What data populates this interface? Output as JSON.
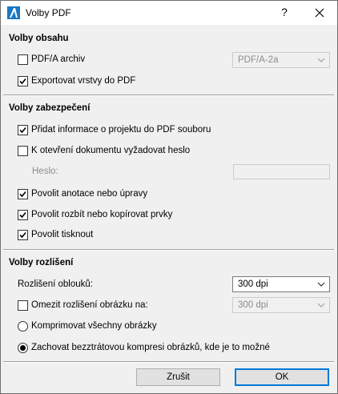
{
  "window": {
    "title": "Volby PDF",
    "help_label": "?"
  },
  "content_section": {
    "title": "Volby obsahu",
    "pdfa": {
      "label": "PDF/A archiv",
      "checked": false,
      "select_value": "PDF/A-2a"
    },
    "export_layers": {
      "label": "Exportovat vrstvy do PDF",
      "checked": true
    }
  },
  "security_section": {
    "title": "Volby zabezpečení",
    "add_project_info": {
      "label": "Přidat informace o projektu do PDF souboru",
      "checked": true
    },
    "require_password": {
      "label": "K otevření dokumentu vyžadovat heslo",
      "checked": false
    },
    "password": {
      "label": "Heslo:",
      "value": ""
    },
    "allow_annotations": {
      "label": "Povolit anotace nebo úpravy",
      "checked": true
    },
    "allow_extract": {
      "label": "Povolit rozbít nebo kopírovat prvky",
      "checked": true
    },
    "allow_print": {
      "label": "Povolit tisknout",
      "checked": true
    }
  },
  "resolution_section": {
    "title": "Volby rozlišení",
    "arc_resolution": {
      "label": "Rozlišení oblouků:",
      "value": "300 dpi"
    },
    "limit_image_resolution": {
      "label": "Omezit rozlišení obrázku na:",
      "checked": false,
      "value": "300 dpi"
    },
    "compress_all": {
      "label": "Komprimovat všechny obrázky",
      "selected": false
    },
    "lossless": {
      "label": "Zachovat bezztrátovou kompresi obrázků, kde je to možné",
      "selected": true
    }
  },
  "buttons": {
    "cancel": "Zrušit",
    "ok": "OK"
  },
  "colors": {
    "accent": "#0078d7",
    "background": "#f0f0f0"
  }
}
